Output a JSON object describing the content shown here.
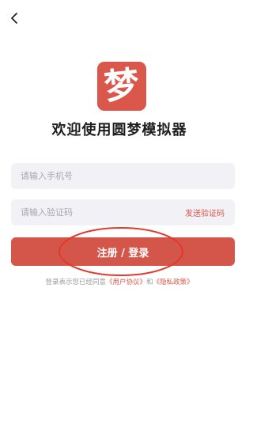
{
  "header": {
    "back_icon": "chevron-left-icon"
  },
  "logo": {
    "char": "梦",
    "bg_color": "#d9574b"
  },
  "welcome": {
    "title": "欢迎使用圆梦模拟器"
  },
  "phone": {
    "value": "",
    "placeholder": "请输入手机号"
  },
  "code": {
    "value": "",
    "placeholder": "请输入验证码",
    "send_label": "发送验证码"
  },
  "login": {
    "label": "注册 / 登录",
    "color": "#d4554a",
    "highlight_color": "#e03a2a"
  },
  "agreement": {
    "prefix": "登录表示您已经同意",
    "user_link": "《用户协议》",
    "and": "和",
    "privacy_link": "《隐私政策》"
  }
}
